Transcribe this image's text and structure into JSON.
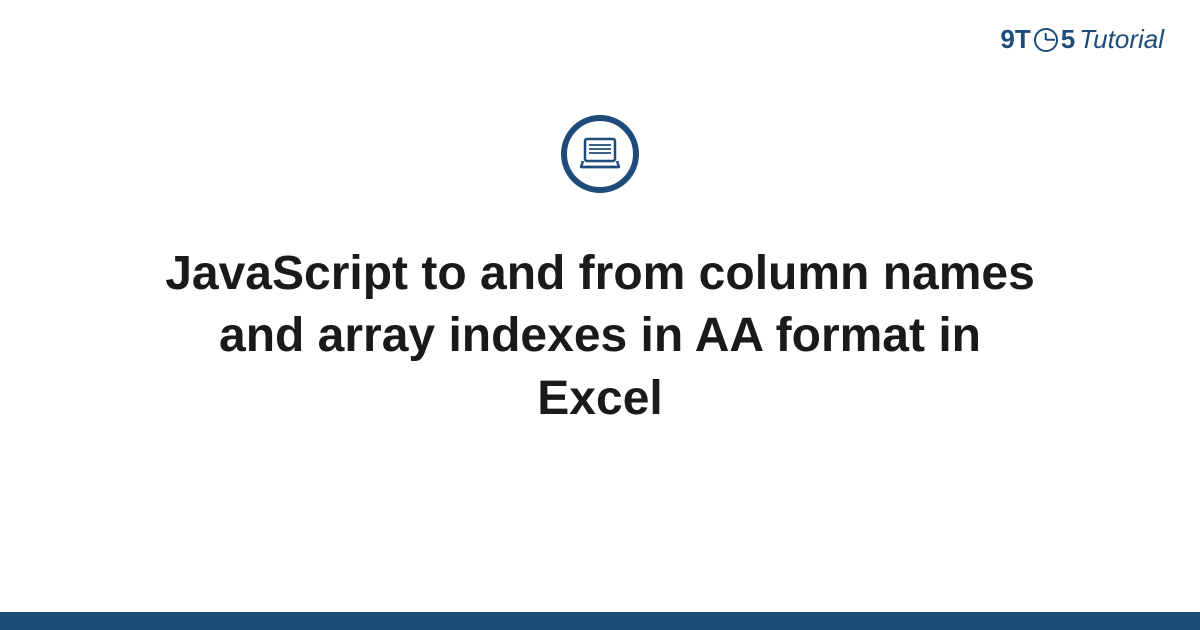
{
  "logo": {
    "part1": "9T",
    "part2": "5",
    "part3": "Tutorial"
  },
  "title": "JavaScript to and from column names and array indexes in AA format in Excel",
  "colors": {
    "brand": "#1d4c7a"
  }
}
